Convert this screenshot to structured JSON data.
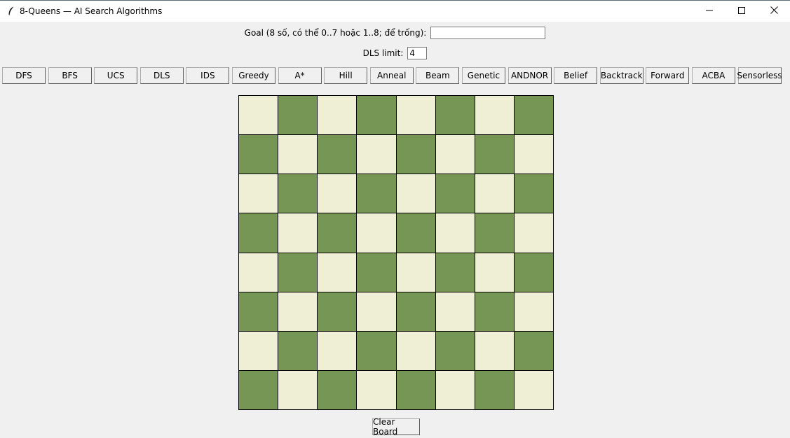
{
  "window": {
    "title": "8-Queens — AI Search Algorithms",
    "app_icon": "feather-icon",
    "controls": [
      "minimize-icon",
      "maximize-icon",
      "close-icon"
    ]
  },
  "goal": {
    "label": "Goal (8 số, có thể 0..7 hoặc 1..8; để trống):",
    "value": "",
    "placeholder": ""
  },
  "dls": {
    "label": "DLS limit:",
    "value": "4"
  },
  "algorithms": [
    {
      "label": "DFS"
    },
    {
      "label": "BFS"
    },
    {
      "label": "UCS"
    },
    {
      "label": "DLS"
    },
    {
      "label": "IDS"
    },
    {
      "label": "Greedy"
    },
    {
      "label": "A*"
    },
    {
      "label": "Hill"
    },
    {
      "label": "Anneal"
    },
    {
      "label": "Beam"
    },
    {
      "label": "Genetic"
    },
    {
      "label": "ANDNOR"
    },
    {
      "label": "Belief"
    },
    {
      "label": "Backtrack"
    },
    {
      "label": "Forward"
    },
    {
      "label": "ACBA"
    },
    {
      "label": "Sensorless"
    }
  ],
  "board": {
    "size": 8,
    "light_color": "#efefd6",
    "dark_color": "#769655",
    "queens": []
  },
  "clear_button": {
    "label": "Clear Board"
  }
}
